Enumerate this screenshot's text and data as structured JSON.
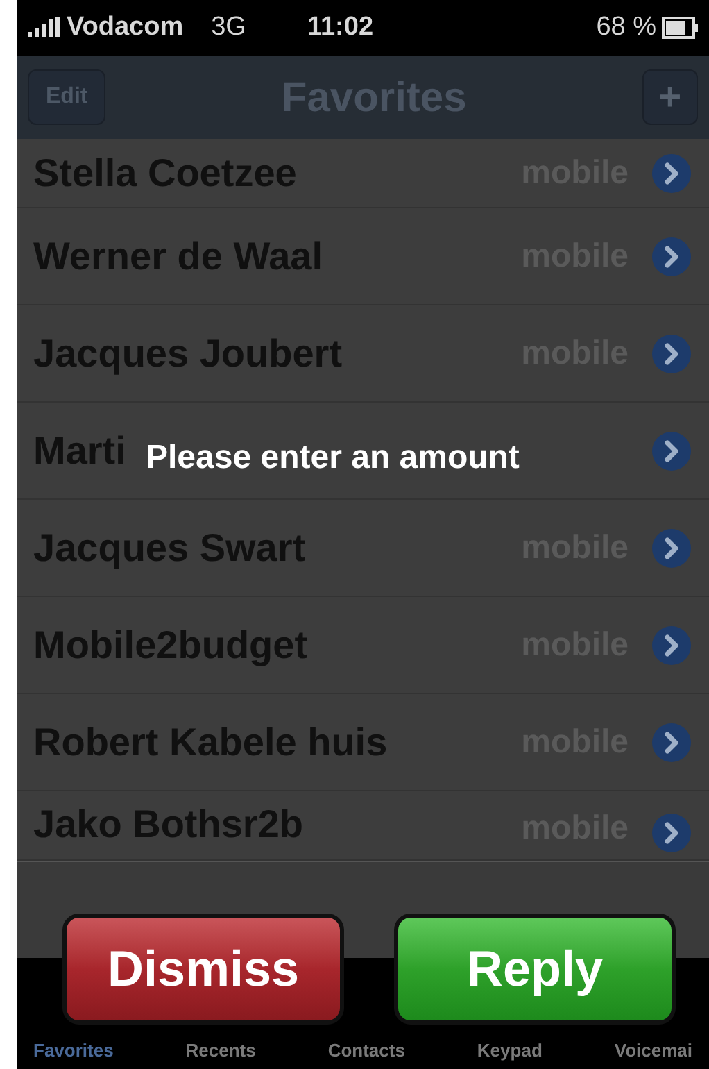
{
  "status_bar": {
    "carrier": "Vodacom",
    "network": "3G",
    "time": "11:02",
    "battery": "68 %"
  },
  "nav_bar": {
    "left_button": "Edit",
    "title": "Favorites",
    "right_button": "+"
  },
  "favorites": [
    {
      "name": "Stella Coetzee",
      "type": "mobile"
    },
    {
      "name": "Werner de Waal",
      "type": "mobile"
    },
    {
      "name": "Jacques Joubert",
      "type": "mobile"
    },
    {
      "name": "Marti"
    },
    {
      "name": "Jacques Swart",
      "type": "mobile"
    },
    {
      "name": "Mobile2budget",
      "type": "mobile"
    },
    {
      "name": "Robert Kabele huis",
      "type": "mobile"
    },
    {
      "name": "Jako Bothsr2b",
      "type": "mobile"
    }
  ],
  "alert": {
    "message": "Please enter an amount",
    "buttons": [
      {
        "label": "Dismiss",
        "kind": "cancel"
      },
      {
        "label": "Reply",
        "kind": "default"
      }
    ]
  },
  "tab_bar": [
    {
      "label": "Favorites",
      "selected": true
    },
    {
      "label": "Recents",
      "selected": false
    },
    {
      "label": "Contacts",
      "selected": false
    },
    {
      "label": "Keypad",
      "selected": false
    },
    {
      "label": "Voicemai",
      "selected": false
    }
  ]
}
